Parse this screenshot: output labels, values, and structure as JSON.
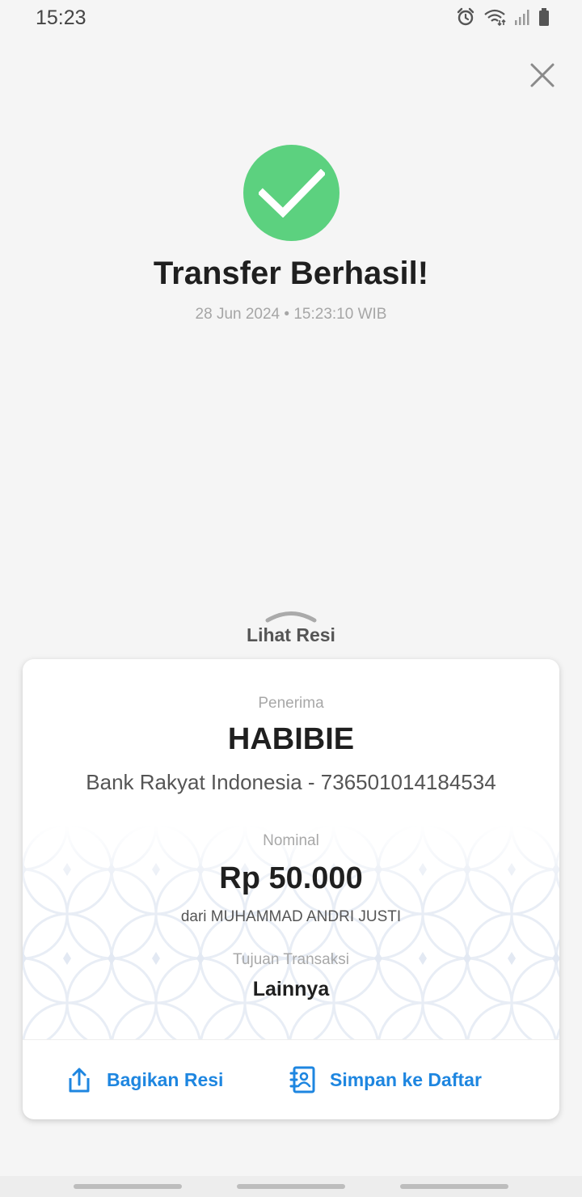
{
  "status_bar": {
    "time": "15:23",
    "icons": [
      "alarm-icon",
      "wifi-icon",
      "signal-icon",
      "battery-icon"
    ]
  },
  "close_icon": "close-icon",
  "success": {
    "icon": "check-icon",
    "title": "Transfer Berhasil!",
    "datetime": "28 Jun 2024 • 15:23:10 WIB",
    "color": "#5cd17f"
  },
  "receipt_toggle": {
    "label": "Lihat Resi",
    "icon": "chevron-up-icon"
  },
  "receipt": {
    "recipient_label": "Penerima",
    "recipient_name": "HABIBIE",
    "recipient_bank": "Bank Rakyat Indonesia - 736501014184534",
    "amount_label": "Nominal",
    "amount": "Rp 50.000",
    "from": "dari MUHAMMAD ANDRI JUSTI",
    "purpose_label": "Tujuan Transaksi",
    "purpose": "Lainnya"
  },
  "actions": {
    "share_label": "Bagikan Resi",
    "share_icon": "share-icon",
    "save_label": "Simpan ke Daftar",
    "save_icon": "contact-book-icon",
    "color": "#1e86e0"
  }
}
